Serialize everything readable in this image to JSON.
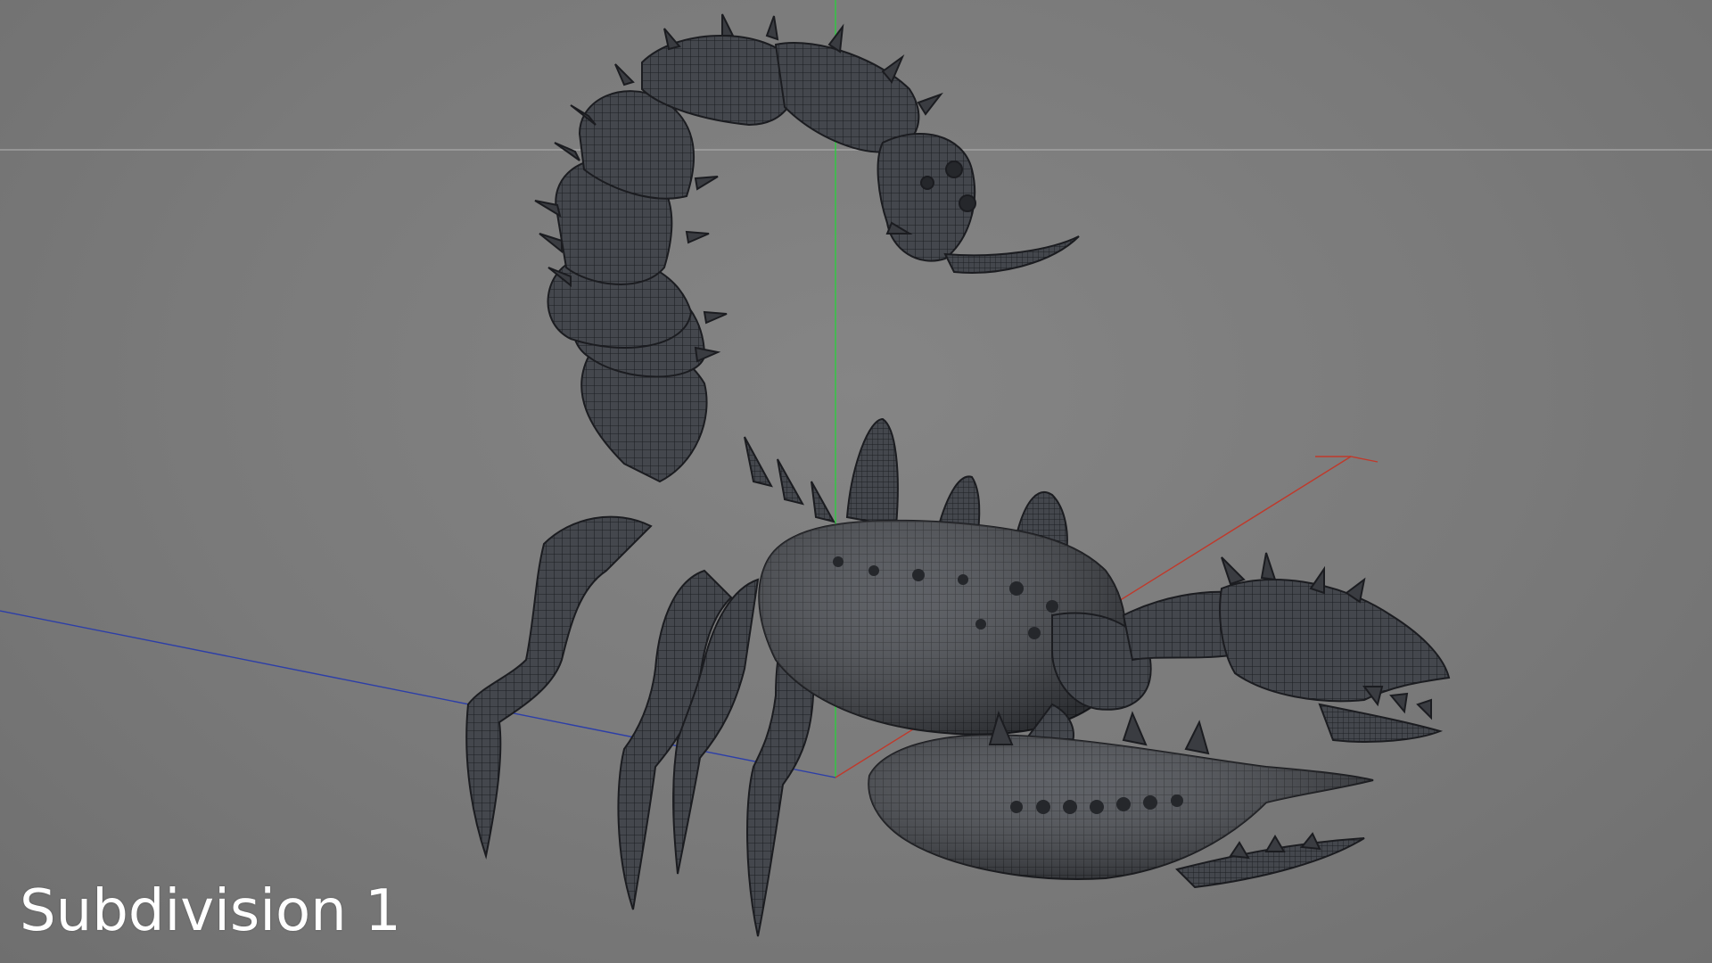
{
  "viewport": {
    "label": "Subdivision 1",
    "background_color": "#7b7b7b",
    "mesh_color": "#3f4146",
    "wire_color": "#1e2024",
    "axis_colors": {
      "x_axis": "#c0392b",
      "y_axis": "#2ecc40",
      "z_axis": "#2c3ea8",
      "horizon": "#a9a9a9"
    },
    "model": "scorpion-wireframe-model"
  }
}
